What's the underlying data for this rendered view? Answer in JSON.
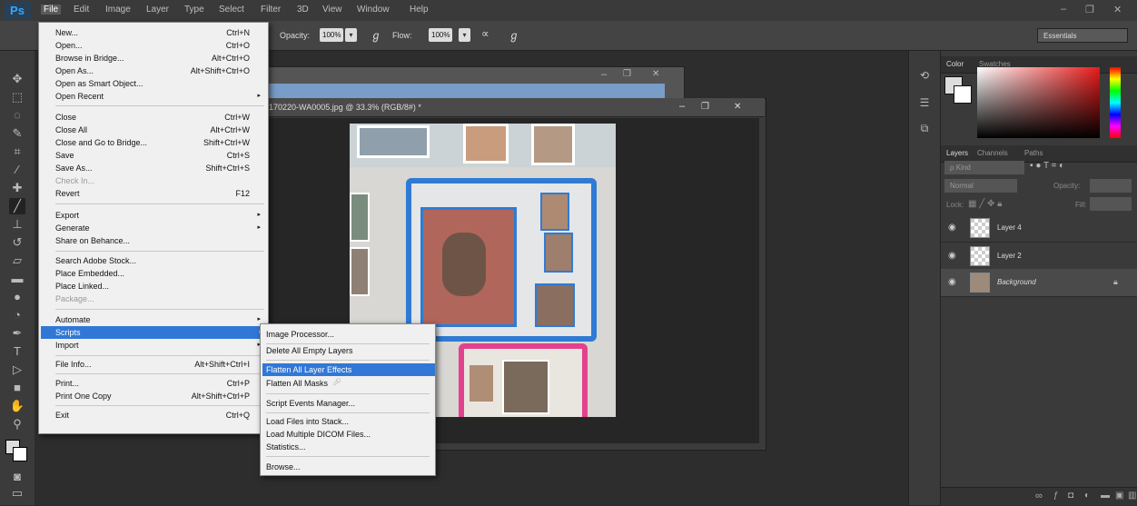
{
  "app": {
    "logo": "Ps"
  },
  "menubar": [
    "File",
    "Edit",
    "Image",
    "Layer",
    "Type",
    "Select",
    "Filter",
    "3D",
    "View",
    "Window",
    "Help"
  ],
  "window_controls": [
    "–",
    "❐",
    "✕"
  ],
  "options": {
    "opacity_label": "Opacity:",
    "opacity_value": "100%",
    "flow_label": "Flow:",
    "flow_value": "100%",
    "workspace": "Essentials"
  },
  "document": {
    "title": "170220-WA0005.jpg @ 33.3% (RGB/8#) *",
    "zoom": "33.33%",
    "controls": [
      "–",
      "❐",
      "✕"
    ]
  },
  "file_menu": {
    "items": [
      {
        "label": "New...",
        "shortcut": "Ctrl+N"
      },
      {
        "label": "Open...",
        "shortcut": "Ctrl+O"
      },
      {
        "label": "Browse in Bridge...",
        "shortcut": "Alt+Ctrl+O"
      },
      {
        "label": "Open As...",
        "shortcut": "Alt+Shift+Ctrl+O"
      },
      {
        "label": "Open as Smart Object...",
        "shortcut": ""
      },
      {
        "label": "Open Recent",
        "shortcut": "",
        "submenu": "▸"
      },
      {
        "label": "Close",
        "shortcut": "Ctrl+W"
      },
      {
        "label": "Close All",
        "shortcut": "Alt+Ctrl+W"
      },
      {
        "label": "Close and Go to Bridge...",
        "shortcut": "Shift+Ctrl+W"
      },
      {
        "label": "Save",
        "shortcut": "Ctrl+S"
      },
      {
        "label": "Save As...",
        "shortcut": "Shift+Ctrl+S"
      },
      {
        "label": "Check In...",
        "shortcut": "",
        "disabled": true
      },
      {
        "label": "Revert",
        "shortcut": "F12"
      },
      {
        "label": "Export",
        "shortcut": "",
        "submenu": "▸"
      },
      {
        "label": "Generate",
        "shortcut": "",
        "submenu": "▸"
      },
      {
        "label": "Share on Behance...",
        "shortcut": ""
      },
      {
        "label": "Search Adobe Stock...",
        "shortcut": ""
      },
      {
        "label": "Place Embedded...",
        "shortcut": ""
      },
      {
        "label": "Place Linked...",
        "shortcut": ""
      },
      {
        "label": "Package...",
        "shortcut": "",
        "disabled": true
      },
      {
        "label": "Automate",
        "shortcut": "",
        "submenu": "▸"
      },
      {
        "label": "Scripts",
        "shortcut": "",
        "submenu": "▸",
        "highlighted": true
      },
      {
        "label": "Import",
        "shortcut": "",
        "submenu": "▸"
      },
      {
        "label": "File Info...",
        "shortcut": "Alt+Shift+Ctrl+I"
      },
      {
        "label": "Print...",
        "shortcut": "Ctrl+P"
      },
      {
        "label": "Print One Copy",
        "shortcut": "Alt+Shift+Ctrl+P"
      },
      {
        "label": "Exit",
        "shortcut": "Ctrl+Q"
      }
    ]
  },
  "scripts_menu": {
    "items": [
      {
        "label": "Image Processor..."
      },
      {
        "label": "Delete All Empty Layers"
      },
      {
        "label": "Flatten All Layer Effects",
        "highlighted": true
      },
      {
        "label": "Flatten All Masks"
      },
      {
        "label": "Script Events Manager..."
      },
      {
        "label": "Load Files into Stack..."
      },
      {
        "label": "Load Multiple DICOM Files..."
      },
      {
        "label": "Statistics..."
      },
      {
        "label": "Browse..."
      }
    ]
  },
  "color_panel": {
    "tabs": [
      "Color",
      "Swatches"
    ]
  },
  "layers_panel": {
    "tabs": [
      "Layers",
      "Channels",
      "Paths"
    ],
    "kind": "ρ Kind",
    "blend": "Normal",
    "opacity_label": "Opacity:",
    "lock_label": "Lock:",
    "fill_label": "Fill:",
    "layers": [
      {
        "name": "Layer 4"
      },
      {
        "name": "Layer 2"
      },
      {
        "name": "Background",
        "locked": true
      }
    ]
  }
}
